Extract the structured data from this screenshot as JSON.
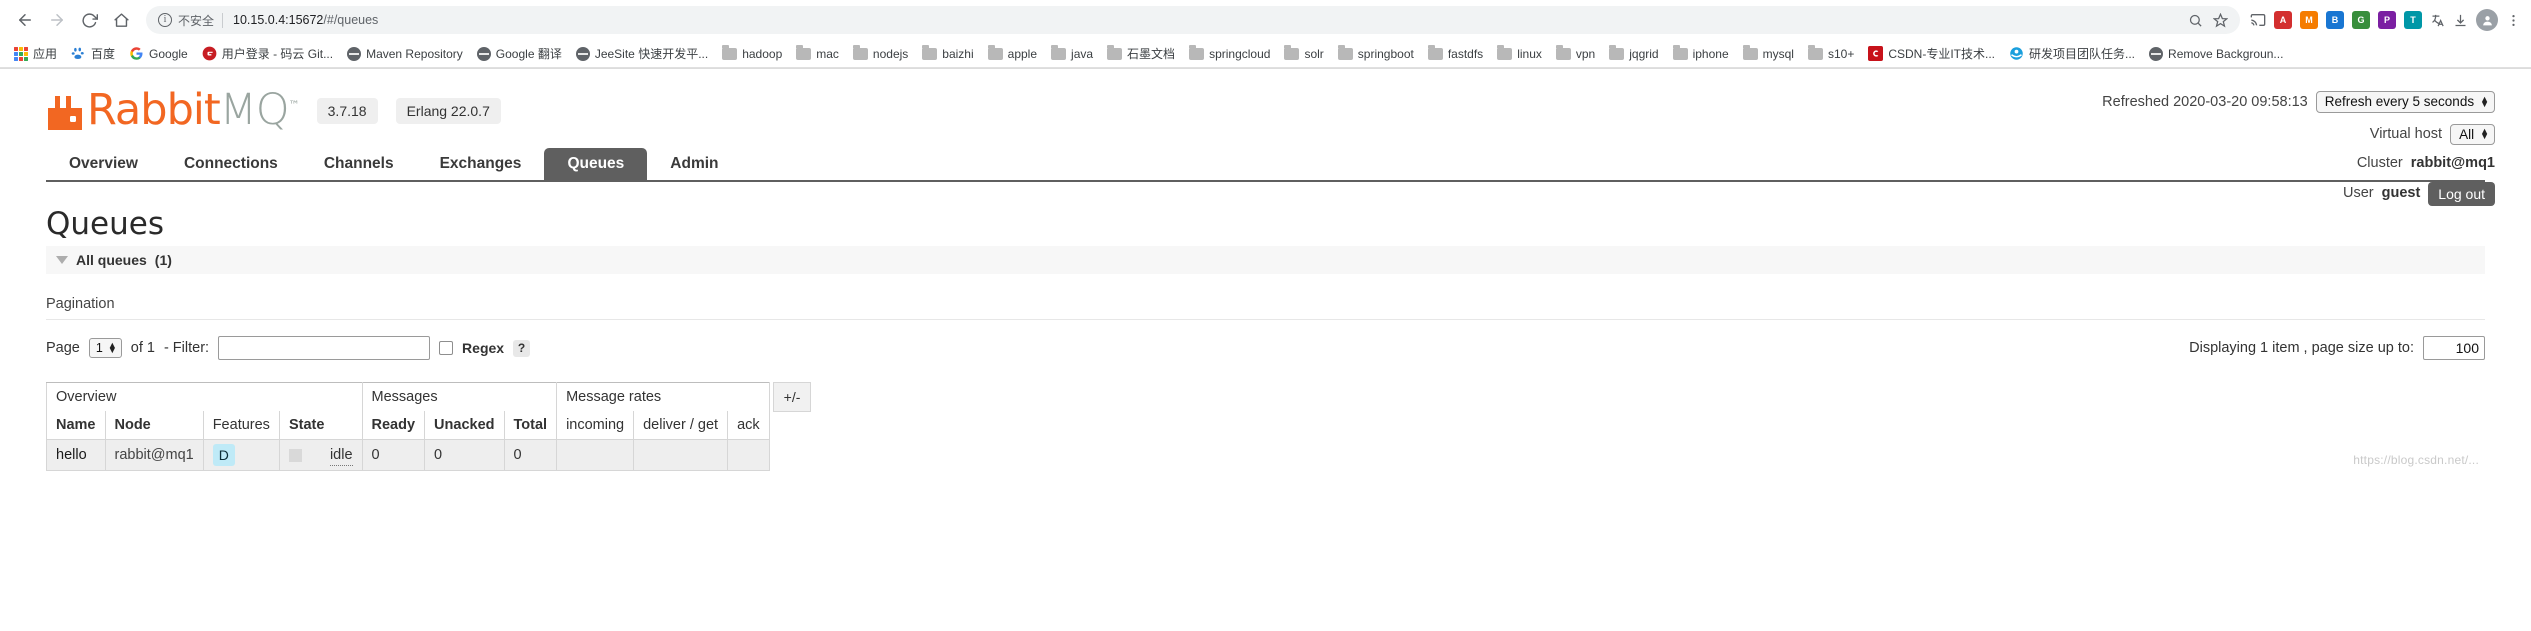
{
  "browser": {
    "nav": {
      "back_icon": "back-arrow-icon",
      "forward_icon": "forward-arrow-icon",
      "reload_icon": "reload-icon",
      "home_icon": "home-icon"
    },
    "omnibox": {
      "security_label": "不安全",
      "url_host": "10.15.0.4:15672",
      "url_path": "/#/queues",
      "info_glyph": "i"
    },
    "toolbar_icons": [
      "zoom-icon",
      "star-icon",
      "cast-icon",
      "puzzle-icon",
      "extension-red-icon",
      "extension-orange-icon",
      "extension-blue-icon",
      "extension-green-icon",
      "extension-purple-icon",
      "extension-teal-icon",
      "translate-icon",
      "download-icon",
      "menu-icon",
      "profile-avatar"
    ],
    "bookmarks": [
      {
        "label": "应用",
        "icon": "apps-grid-icon"
      },
      {
        "label": "百度",
        "icon": "baidu-icon"
      },
      {
        "label": "Google",
        "icon": "google-icon"
      },
      {
        "label": "用户登录 - 码云 Git...",
        "icon": "gitee-icon"
      },
      {
        "label": "Maven Repository",
        "icon": "globe-icon"
      },
      {
        "label": "Google 翻译",
        "icon": "globe-icon"
      },
      {
        "label": "JeeSite 快速开发平...",
        "icon": "globe-icon"
      },
      {
        "label": "hadoop",
        "icon": "folder-icon"
      },
      {
        "label": "mac",
        "icon": "folder-icon"
      },
      {
        "label": "nodejs",
        "icon": "folder-icon"
      },
      {
        "label": "baizhi",
        "icon": "folder-icon"
      },
      {
        "label": "apple",
        "icon": "folder-icon"
      },
      {
        "label": "java",
        "icon": "folder-icon"
      },
      {
        "label": "石墨文档",
        "icon": "folder-icon"
      },
      {
        "label": "springcloud",
        "icon": "folder-icon"
      },
      {
        "label": "solr",
        "icon": "folder-icon"
      },
      {
        "label": "springboot",
        "icon": "folder-icon"
      },
      {
        "label": "fastdfs",
        "icon": "folder-icon"
      },
      {
        "label": "linux",
        "icon": "folder-icon"
      },
      {
        "label": "vpn",
        "icon": "folder-icon"
      },
      {
        "label": "jqgrid",
        "icon": "folder-icon"
      },
      {
        "label": "iphone",
        "icon": "folder-icon"
      },
      {
        "label": "mysql",
        "icon": "folder-icon"
      },
      {
        "label": "s10+",
        "icon": "folder-icon"
      },
      {
        "label": "CSDN-专业IT技术...",
        "icon": "csdn-icon"
      },
      {
        "label": "研发项目团队任务...",
        "icon": "ie-icon"
      },
      {
        "label": "Remove Backgroun...",
        "icon": "globe-icon"
      }
    ]
  },
  "app": {
    "logo_rabbit": "Rabbit",
    "logo_mq": "MQ",
    "logo_tm": "™",
    "version": "3.7.18",
    "erlang": "Erlang 22.0.7",
    "accent_color": "#f26722"
  },
  "header_right": {
    "refreshed_label": "Refreshed 2020-03-20 09:58:13",
    "refresh_select": "Refresh every 5 seconds",
    "vhost_label": "Virtual host",
    "vhost_value": "All",
    "cluster_label": "Cluster",
    "cluster_value": "rabbit@mq1",
    "user_label": "User",
    "user_value": "guest",
    "logout_label": "Log out"
  },
  "tabs": [
    {
      "label": "Overview",
      "active": false
    },
    {
      "label": "Connections",
      "active": false
    },
    {
      "label": "Channels",
      "active": false
    },
    {
      "label": "Exchanges",
      "active": false
    },
    {
      "label": "Queues",
      "active": true
    },
    {
      "label": "Admin",
      "active": false
    }
  ],
  "main": {
    "title": "Queues",
    "section_label": "All queues",
    "section_count": "(1)",
    "pagination_label": "Pagination",
    "page_word": "Page",
    "page_value": "1",
    "of_label": "of 1",
    "filter_label": "- Filter:",
    "filter_value": "",
    "filter_placeholder": "",
    "regex_label": "Regex",
    "help_label": "?",
    "displaying_label": "Displaying 1 item , page size up to:",
    "page_size_value": "100",
    "plus_minus_label": "+/-"
  },
  "table": {
    "groups": [
      {
        "label": "Overview",
        "span": 4
      },
      {
        "label": "Messages",
        "span": 3
      },
      {
        "label": "Message rates",
        "span": 3
      }
    ],
    "columns": [
      {
        "label": "Name",
        "bold": true,
        "align": "left"
      },
      {
        "label": "Node",
        "bold": true,
        "align": "left"
      },
      {
        "label": "Features",
        "bold": false,
        "align": "left"
      },
      {
        "label": "State",
        "bold": true,
        "align": "left"
      },
      {
        "label": "Ready",
        "bold": true,
        "align": "left"
      },
      {
        "label": "Unacked",
        "bold": true,
        "align": "left"
      },
      {
        "label": "Total",
        "bold": true,
        "align": "left"
      },
      {
        "label": "incoming",
        "bold": false,
        "align": "left"
      },
      {
        "label": "deliver / get",
        "bold": false,
        "align": "left"
      },
      {
        "label": "ack",
        "bold": false,
        "align": "left"
      }
    ],
    "rows": [
      {
        "name": "hello",
        "node": "rabbit@mq1",
        "features": "D",
        "state": "idle",
        "ready": "0",
        "unacked": "0",
        "total": "0",
        "incoming": "",
        "deliver_get": "",
        "ack": ""
      }
    ]
  },
  "watermark": "https://blog.csdn.net/..."
}
